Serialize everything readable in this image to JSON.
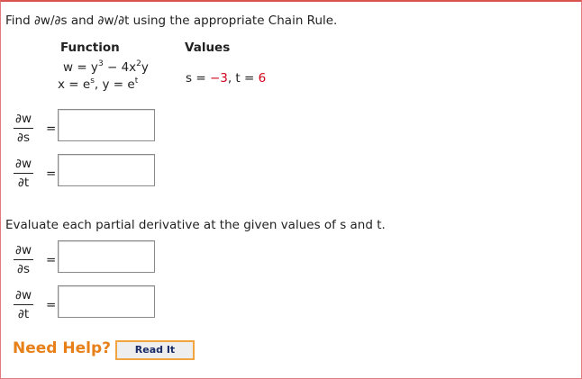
{
  "question": "Find ∂w/∂s and ∂w/∂t using the appropriate Chain Rule.",
  "table": {
    "function_header": "Function",
    "values_header": "Values",
    "function_line1_prefix": "w = y",
    "function_line1_exp1": "3",
    "function_line1_mid": " − 4x",
    "function_line1_exp2": "2",
    "function_line1_suffix": "y",
    "function_line2_prefix": "x = e",
    "function_line2_exp1": "s",
    "function_line2_mid": ",  y = e",
    "function_line2_exp2": "t",
    "values_s_label": "s = ",
    "values_s": "−3",
    "values_sep": ",  t = ",
    "values_t": "6"
  },
  "fractions": {
    "numerator": "∂w",
    "den_s": "∂s",
    "den_t": "∂t",
    "equals": "="
  },
  "evaluate_text": "Evaluate each partial derivative at the given values of s and t.",
  "help": {
    "label": "Need Help?",
    "read_it": "Read It"
  },
  "colors": {
    "given_value": "#d0021b",
    "help_text": "#e8801a"
  }
}
